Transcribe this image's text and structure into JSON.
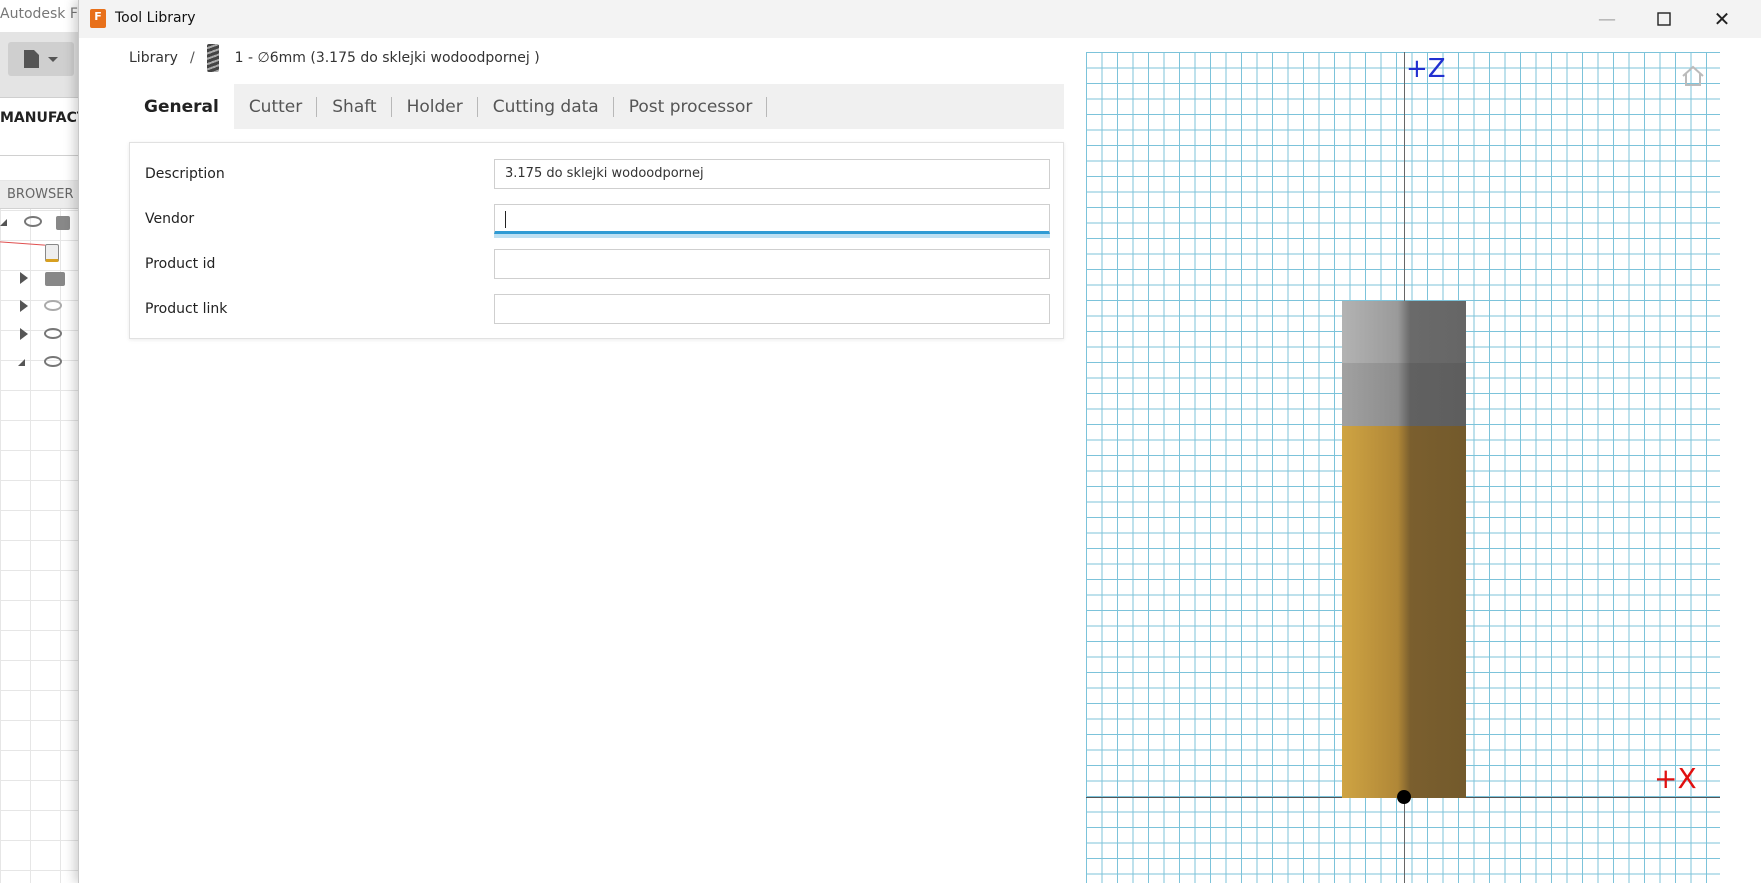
{
  "background_app": {
    "title": "Autodesk Fu",
    "workspace": "MANUFACTU",
    "browser_label": "BROWSER"
  },
  "window": {
    "app_icon_letter": "F",
    "title": "Tool Library",
    "close_glyph": "✕",
    "max_glyph": "☐",
    "min_glyph": "—"
  },
  "breadcrumb": {
    "library": "Library",
    "separator": "/",
    "tool": "1 - ∅6mm (3.175 do sklejki wodoodpornej )"
  },
  "tabs": [
    {
      "label": "General",
      "active": true
    },
    {
      "label": "Cutter",
      "active": false
    },
    {
      "label": "Shaft",
      "active": false
    },
    {
      "label": "Holder",
      "active": false
    },
    {
      "label": "Cutting data",
      "active": false
    },
    {
      "label": "Post processor",
      "active": false
    }
  ],
  "form": {
    "description": {
      "label": "Description",
      "value": "3.175 do sklejki wodoodpornej"
    },
    "vendor": {
      "label": "Vendor",
      "value": ""
    },
    "product_id": {
      "label": "Product id",
      "value": ""
    },
    "product_link": {
      "label": "Product link",
      "value": ""
    }
  },
  "preview": {
    "z_axis_label": "+Z",
    "x_axis_label": "+X",
    "home_icon": "home-icon",
    "colors": {
      "grid": "#7cc3da",
      "cutter": "#b08737",
      "shank": "#8c8c8c",
      "z_axis": "#2230d0",
      "x_axis": "#e01010"
    }
  }
}
